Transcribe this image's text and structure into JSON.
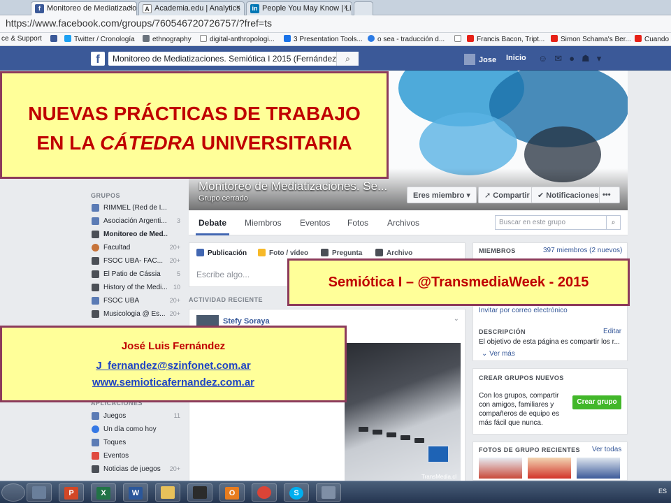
{
  "browser": {
    "tabs": [
      {
        "label": "Monitoreo de Mediatizacio",
        "icon": "facebook-icon",
        "close": "×"
      },
      {
        "label": "Academia.edu | Analytics",
        "icon": "academia-icon",
        "close": "×"
      },
      {
        "label": "People You May Know | Li",
        "icon": "linkedin-icon",
        "close": "×"
      }
    ],
    "url": "https://www.facebook.com/groups/760546720726757/?fref=ts",
    "bookmarks": [
      "ce & Support",
      "Twitter / Cronología",
      "ethnography",
      "digital-anthropologi...",
      "3 Presentation Tools...",
      "o sea - traducción d...",
      "Francis Bacon, Tript...",
      "Simon Schama's Ber...",
      "Cuando"
    ]
  },
  "facebook": {
    "logo": "f",
    "search_value": "Monitoreo de Mediatizaciones. Semiótica I 2015 (Fernández)",
    "user": "Jose",
    "home": "Inicio",
    "group_name": "Monitoreo de Mediatizaciones. Se...",
    "group_type": "Grupo cerrado",
    "buttons": {
      "member": "Eres miembro ▾",
      "share": "Compartir",
      "notif": "Notificaciones",
      "more": "•••"
    },
    "tabs": [
      "Debate",
      "Miembros",
      "Eventos",
      "Fotos",
      "Archivos"
    ],
    "group_search_placeholder": "Buscar en este grupo",
    "composer": {
      "tabs": [
        "Publicación",
        "Foto / vídeo",
        "Pregunta",
        "Archivo"
      ],
      "placeholder": "Escribe algo..."
    },
    "activity_heading": "ACTIVIDAD RECIENTE",
    "post": {
      "author": "Stefy Soraya",
      "photo_mark": "TransMedia.cl"
    },
    "sidebar": {
      "groups_heading": "GRUPOS",
      "groups": [
        {
          "label": "RIMMEL (Red de I...",
          "count": ""
        },
        {
          "label": "Asociación Argenti...",
          "count": "3"
        },
        {
          "label": "Monitoreo de Med...",
          "count": ""
        },
        {
          "label": "Facultad",
          "count": "20+"
        },
        {
          "label": "FSOC UBA- FAC...",
          "count": "20+"
        },
        {
          "label": "El Patio de Cássia",
          "count": "5"
        },
        {
          "label": "History of the Medi...",
          "count": "10"
        },
        {
          "label": "FSOC UBA",
          "count": "20+"
        },
        {
          "label": "Musicologia @ Es...",
          "count": "20+"
        }
      ],
      "apps_heading": "APLICACIONES",
      "apps": [
        {
          "label": "Juegos",
          "count": "11"
        },
        {
          "label": "Un día como hoy",
          "count": ""
        },
        {
          "label": "Toques",
          "count": ""
        },
        {
          "label": "Eventos",
          "count": ""
        },
        {
          "label": "Noticias de juegos",
          "count": "20+"
        }
      ]
    },
    "right": {
      "members_heading": "MIEMBROS",
      "members_count": "397 miembros (2 nuevos)",
      "invite": "Invitar por correo electrónico",
      "desc_heading": "DESCRIPCIÓN",
      "desc_edit": "Editar",
      "desc_text": "El objetivo de esta página es compartir los r...",
      "see_more": "Ver más",
      "create_heading": "CREAR GRUPOS NUEVOS",
      "create_text": [
        "Con los grupos, compartir",
        "con amigos, familiares y",
        "compañeros de equipo es",
        "más fácil que nunca."
      ],
      "create_button": "Crear grupo",
      "photos_heading": "FOTOS DE GRUPO RECIENTES",
      "photos_link": "Ver todas"
    }
  },
  "taskbar": {
    "language": "ES"
  },
  "overlays": {
    "title_line1": "NUEVAS PRÁCTICAS DE TRABAJO",
    "title_line2_a": "EN LA ",
    "title_line2_b": "CÁTEDRA",
    "title_line2_c": " UNIVERSITARIA",
    "subtitle": "Semiótica I –  @TransmediaWeek  - 2015",
    "author": "José Luis Fernández",
    "email": "J_fernandez@szinfonet.com.ar",
    "website": "www.semioticafernandez.com.ar"
  }
}
